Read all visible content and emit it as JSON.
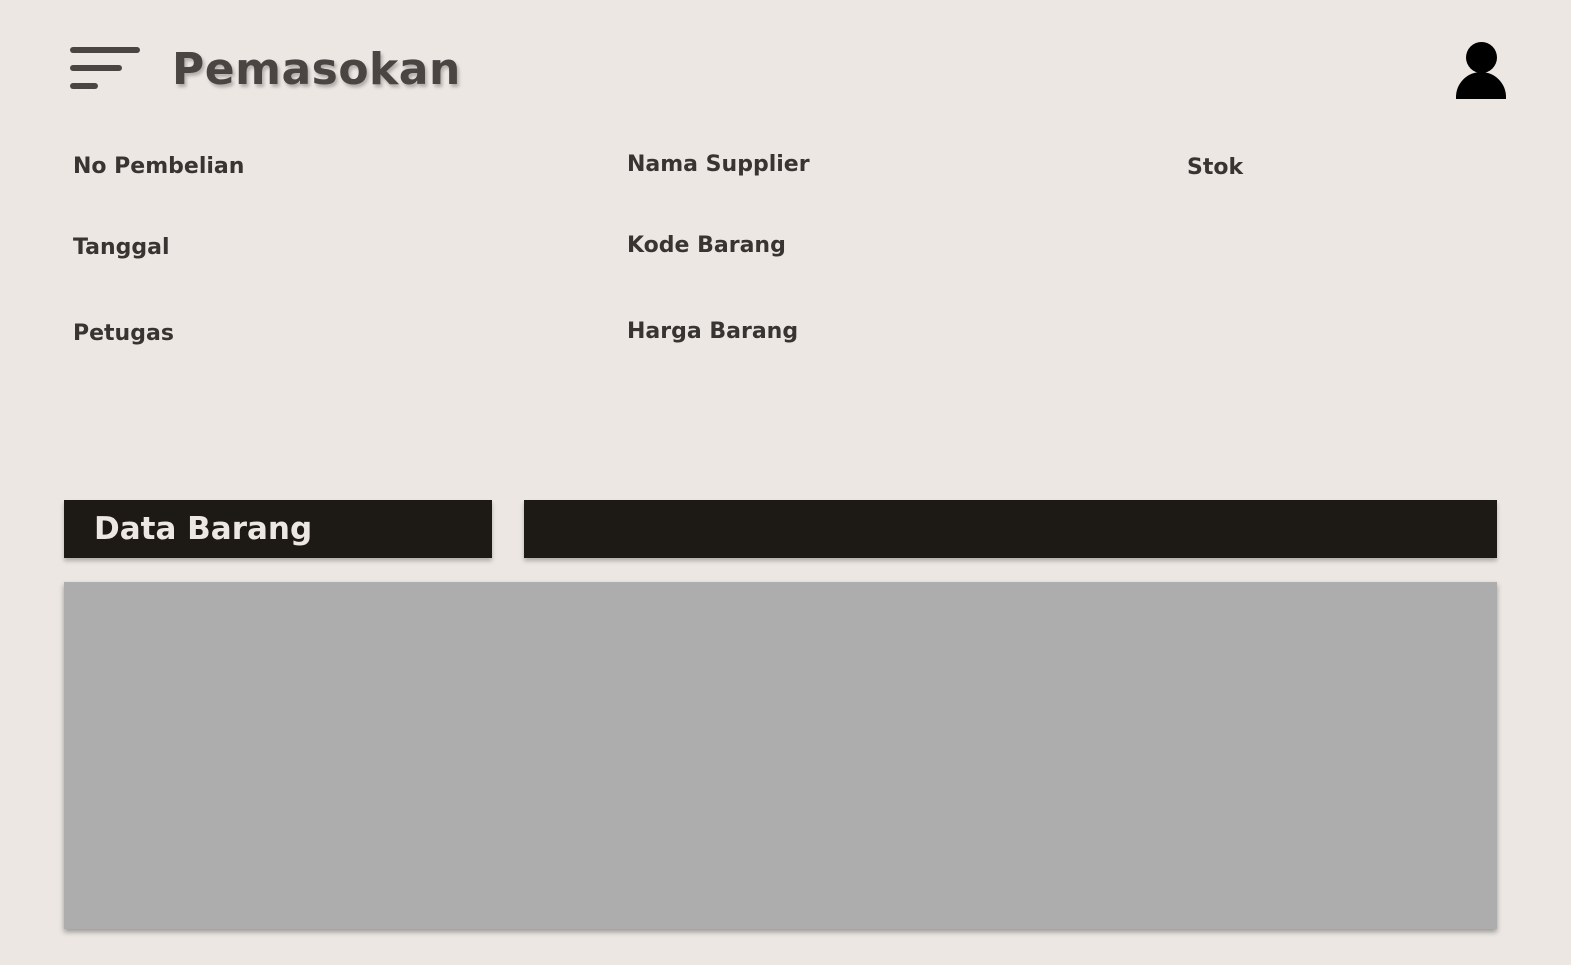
{
  "header": {
    "title": "Pemasokan",
    "menu_icon": "hamburger-menu-icon",
    "user_icon": "user-account-icon"
  },
  "form": {
    "no_pembelian": "No Pembelian",
    "tanggal": "Tanggal",
    "petugas": "Petugas",
    "nama_supplier": "Nama Supplier",
    "kode_barang": "Kode Barang",
    "harga_barang": "Harga Barang",
    "stok": "Stok"
  },
  "data_section": {
    "title": "Data Barang"
  },
  "colors": {
    "background": "#ece7e3",
    "header_text": "#4a4542",
    "bar": "#1d1a16",
    "panel": "#adadad"
  }
}
